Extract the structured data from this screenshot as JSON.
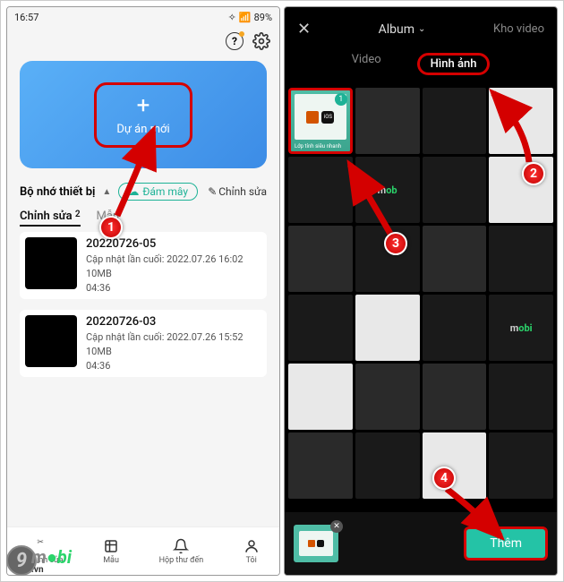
{
  "left": {
    "status": {
      "time": "16:57",
      "battery": "89%"
    },
    "hero": {
      "label": "Dự án mới"
    },
    "storage": {
      "title": "Bộ nhớ thiết bị",
      "cloud_label": "Đám mây",
      "edit_label": "Chỉnh sửa"
    },
    "tabs": {
      "edited": "Chỉnh sửa",
      "edited_count": "2",
      "template": "Mẫu"
    },
    "projects": [
      {
        "name": "20220726-05",
        "updated": "Cập nhật lần cuối: 2022.07.26 16:02",
        "size": "10MB",
        "duration": "04:36"
      },
      {
        "name": "20220726-03",
        "updated": "Cập nhật lần cuối: 2022.07.26 15:52",
        "size": "10MB",
        "duration": "04:36"
      }
    ],
    "nav": {
      "edit": "Chỉnh sửa",
      "template": "Mẫu",
      "inbox": "Hộp thư đến",
      "me": "Tôi"
    }
  },
  "right": {
    "top": {
      "album_label": "Album",
      "stock_label": "Kho video"
    },
    "tabs": {
      "video": "Video",
      "image": "Hình ảnh"
    },
    "selected_caption": "Lớp tính siêu nhanh",
    "add_label": "Thêm"
  },
  "annotations": {
    "n1": "1",
    "n2": "2",
    "n3": "3",
    "n4": "4"
  },
  "watermark": {
    "nine": "9",
    "brand1": "m",
    "brand2": "bi",
    "vn": ".vn"
  }
}
